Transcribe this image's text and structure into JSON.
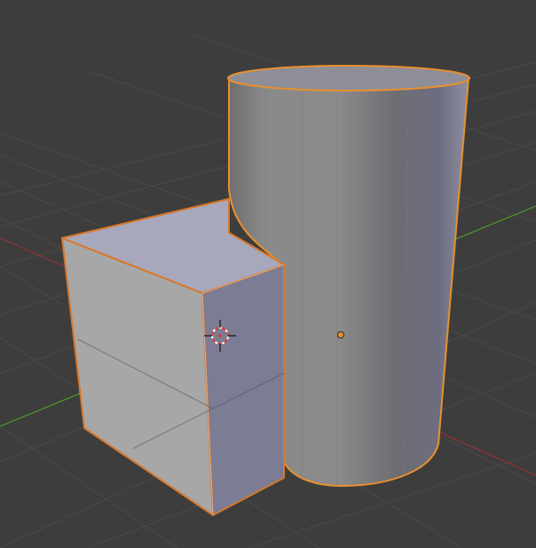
{
  "viewport": {
    "background": "#3d3d3d",
    "view": "user-perspective"
  },
  "scene": {
    "objects": [
      {
        "name": "Cube",
        "selected": true,
        "color": "#b7b7c9"
      },
      {
        "name": "Cylinder",
        "selected": true,
        "active": true,
        "color": "#8f8f96"
      }
    ],
    "cursor_icon": "3d-cursor-icon",
    "selection_outline_color": "#e8902e"
  },
  "axes": {
    "x_color": "#b83434",
    "y_color": "#4c9a2a",
    "grid_color": "#4a4a4a"
  }
}
